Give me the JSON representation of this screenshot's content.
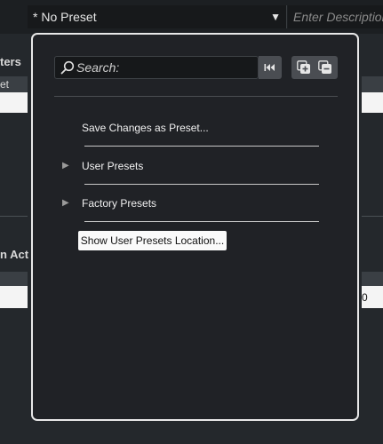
{
  "preset": {
    "current": "* No Preset",
    "description_placeholder": "Enter Description"
  },
  "background": {
    "label_left_top": "ters",
    "label_left_cell": "et",
    "label_left_mid": "n Act",
    "label_right_cell": "0"
  },
  "popup": {
    "search_placeholder": "Search:",
    "menu": {
      "save_changes": "Save Changes as Preset...",
      "user_presets": "User Presets",
      "factory_presets": "Factory Presets",
      "show_location": "Show User Presets Location..."
    }
  },
  "icons": {
    "search": "search-icon",
    "rewind": "skip-to-start-icon",
    "add": "add-preset-icon",
    "remove": "remove-preset-icon",
    "expand": "triangle-right-icon",
    "dropdown": "triangle-down-icon"
  }
}
